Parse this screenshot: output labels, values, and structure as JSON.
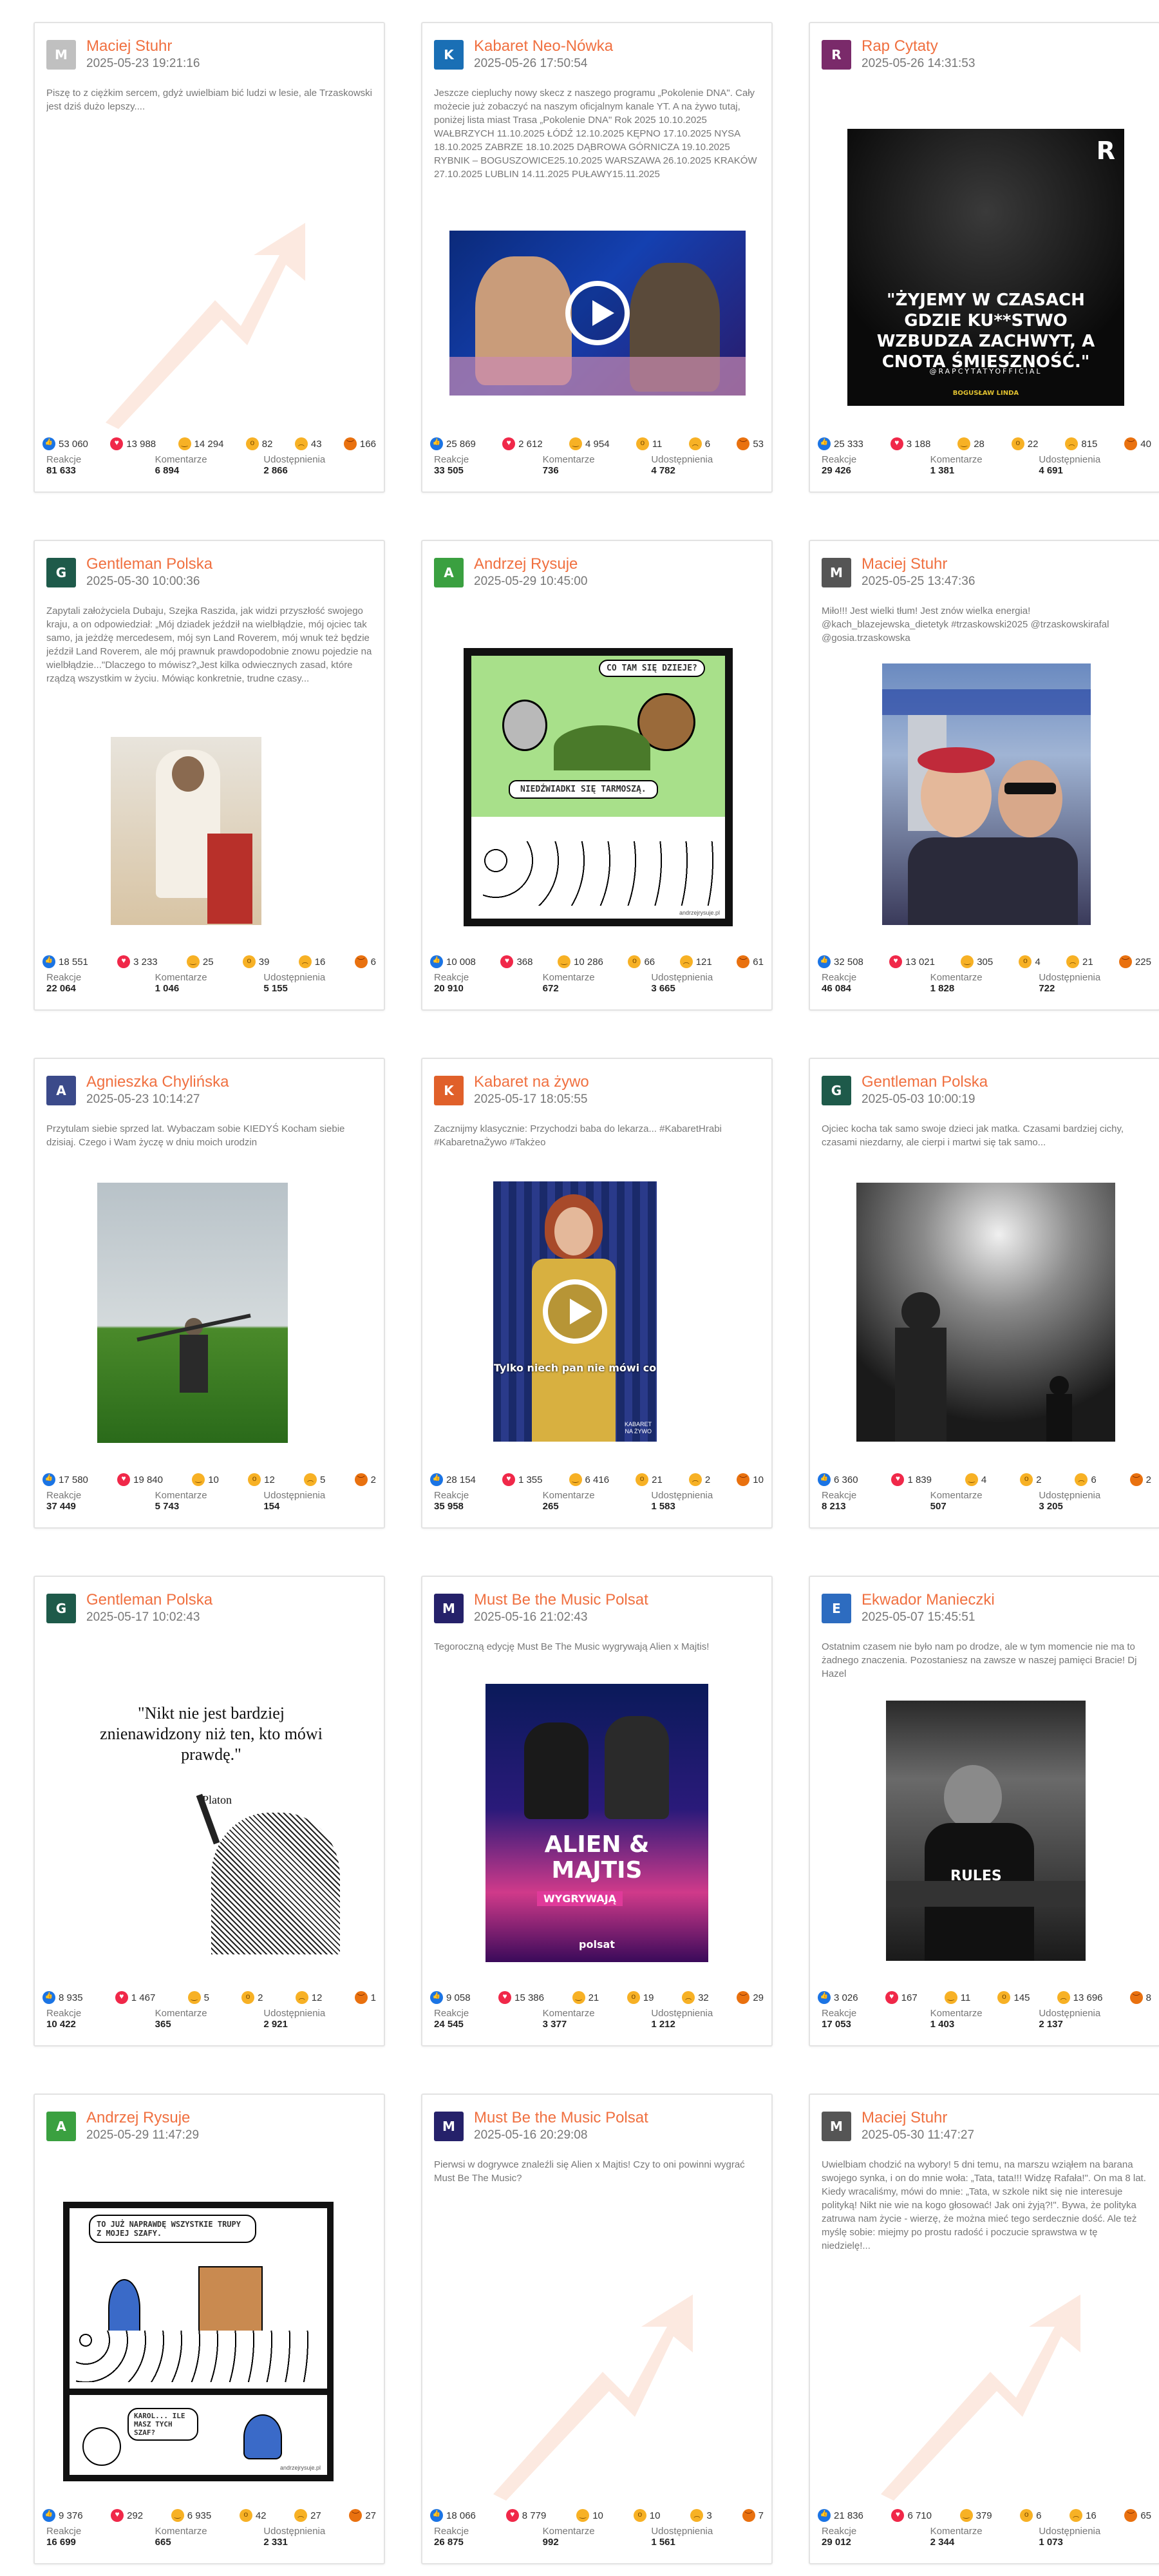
{
  "labels": {
    "reactions": "Reakcje",
    "comments": "Komentarze",
    "shares": "Udostępnienia"
  },
  "colors": {
    "author": "#f07040",
    "like": "#1b74e4",
    "love": "#f02849",
    "haha": "#f7b125",
    "angry": "#e9710f"
  },
  "posts": [
    {
      "author": "Maciej Stuhr",
      "date": "2025-05-23 19:21:16",
      "text": "Piszę to z ciężkim sercem, gdyż uwielbiam bić ludzi w lesie, ale Trzaskowski jest dziś dużo lepszy....",
      "reactions": {
        "like": "53 060",
        "love": "13 988",
        "haha": "14 294",
        "wow": "82",
        "sad": "43",
        "angry": "166"
      },
      "totals": {
        "reactions": "81 633",
        "comments": "6 894",
        "shares": "2 866"
      }
    },
    {
      "author": "Kabaret Neo-Nówka",
      "date": "2025-05-26 17:50:54",
      "text": "Jeszcze ciepluchy nowy skecz z naszego programu „Pokolenie DNA\". Cały możecie już zobaczyć na naszym oficjalnym kanale YT. A na żywo tutaj, poniżej lista miast Trasa „Pokolenie DNA\" Rok 2025 10.10.2025 WAŁBRZYCH 11.10.2025 ŁÓDŹ 12.10.2025 KĘPNO 17.10.2025 NYSA 18.10.2025 ZABRZE 18.10.2025 DĄBROWA GÓRNICZA 19.10.2025 RYBNIK – BOGUSZOWICE25.10.2025 WARSZAWA 26.10.2025 KRAKÓW 27.10.2025 LUBLIN 14.11.2025 PUŁAWY15.11.2025",
      "reactions": {
        "like": "25 869",
        "love": "2 612",
        "haha": "4 954",
        "wow": "11",
        "sad": "6",
        "angry": "53"
      },
      "totals": {
        "reactions": "33 505",
        "comments": "736",
        "shares": "4 782"
      }
    },
    {
      "author": "Rap Cytaty",
      "date": "2025-05-26 14:31:53",
      "text": "",
      "media_text": "\"ŻYJEMY W CZASACH GDZIE KU**STWO WZBUDZA ZACHWYT, A CNOTA ŚMIESZNOŚĆ.\"",
      "media_sub": "@RAPCYTATYOFFICIAL",
      "media_credit": "BOGUSŁAW LINDA",
      "reactions": {
        "like": "25 333",
        "love": "3 188",
        "haha": "28",
        "wow": "22",
        "sad": "815",
        "angry": "40"
      },
      "totals": {
        "reactions": "29 426",
        "comments": "1 381",
        "shares": "4 691"
      }
    },
    {
      "author": "Gentleman Polska",
      "date": "2025-05-30 10:00:36",
      "text": "Zapytali założyciela Dubaju, Szejka Raszida, jak widzi przyszłość swojego kraju, a on odpowiedział: „Mój dziadek jeździł na wielbłądzie, mój ojciec tak samo, ja jeżdżę mercedesem, mój syn Land Roverem, mój wnuk też będzie jeździł Land Roverem, ale mój prawnuk prawdopodobnie znowu pojedzie na wielbłądzie...\"Dlaczego to mówisz?„Jest kilka odwiecznych zasad, które rządzą wszystkim w życiu. Mówiąc konkretnie, trudne czasy...",
      "reactions": {
        "like": "18 551",
        "love": "3 233",
        "haha": "25",
        "wow": "39",
        "sad": "16",
        "angry": "6"
      },
      "totals": {
        "reactions": "22 064",
        "comments": "1 046",
        "shares": "5 155"
      }
    },
    {
      "author": "Andrzej Rysuje",
      "date": "2025-05-29 10:45:00",
      "text": "",
      "media_text": "CO TAM SIĘ DZIEJE?",
      "media_sub": "NIEDŹWIADKI SIĘ TARMOSZĄ.",
      "media_credit": "andrzejrysuje.pl",
      "reactions": {
        "like": "10 008",
        "love": "368",
        "haha": "10 286",
        "wow": "66",
        "sad": "121",
        "angry": "61"
      },
      "totals": {
        "reactions": "20 910",
        "comments": "672",
        "shares": "3 665"
      }
    },
    {
      "author": "Maciej Stuhr",
      "date": "2025-05-25 13:47:36",
      "text": "Miło!!! Jest wielki tłum! Jest znów wielka energia! @kach_blazejewska_dietetyk #trzaskowski2025 @trzaskowskirafal @gosia.trzaskowska",
      "reactions": {
        "like": "32 508",
        "love": "13 021",
        "haha": "305",
        "wow": "4",
        "sad": "21",
        "angry": "225"
      },
      "totals": {
        "reactions": "46 084",
        "comments": "1 828",
        "shares": "722"
      }
    },
    {
      "author": "Agnieszka Chylińska",
      "date": "2025-05-23 10:14:27",
      "text": "Przytulam siebie sprzed lat. Wybaczam sobie KIEDYŚ Kocham siebie dzisiaj. Czego i Wam życzę w dniu moich urodzin",
      "reactions": {
        "like": "17 580",
        "love": "19 840",
        "haha": "10",
        "wow": "12",
        "sad": "5",
        "angry": "2"
      },
      "totals": {
        "reactions": "37 449",
        "comments": "5 743",
        "shares": "154"
      }
    },
    {
      "author": "Kabaret na żywo",
      "date": "2025-05-17 18:05:55",
      "text": "Zacznijmy klasycznie: Przychodzi baba do lekarza... #KabaretHrabi #KabaretnaŻywo #Takżeo",
      "media_text": "Tylko niech pan nie mówi co",
      "media_credit": "KABARET NA ŻYWO",
      "reactions": {
        "like": "28 154",
        "love": "1 355",
        "haha": "6 416",
        "wow": "21",
        "sad": "2",
        "angry": "10"
      },
      "totals": {
        "reactions": "35 958",
        "comments": "265",
        "shares": "1 583"
      }
    },
    {
      "author": "Gentleman Polska",
      "date": "2025-05-03 10:00:19",
      "text": "Ojciec kocha tak samo swoje dzieci jak matka. Czasami bardziej cichy, czasami niezdarny, ale cierpi i martwi się tak samo...",
      "reactions": {
        "like": "6 360",
        "love": "1 839",
        "haha": "4",
        "wow": "2",
        "sad": "6",
        "angry": "2"
      },
      "totals": {
        "reactions": "8 213",
        "comments": "507",
        "shares": "3 205"
      }
    },
    {
      "author": "Gentleman Polska",
      "date": "2025-05-17 10:02:43",
      "text": "",
      "media_text": "\"Nikt nie jest bardziej znienawidzony niż ten, kto mówi prawdę.\"",
      "media_sub": "-Platon",
      "reactions": {
        "like": "8 935",
        "love": "1 467",
        "haha": "5",
        "wow": "2",
        "sad": "12",
        "angry": "1"
      },
      "totals": {
        "reactions": "10 422",
        "comments": "365",
        "shares": "2 921"
      }
    },
    {
      "author": "Must Be the Music Polsat",
      "date": "2025-05-16 21:02:43",
      "text": "Tegoroczną edycję Must Be The Music wygrywają Alien x Majtis!",
      "media_text": "ALIEN & MAJTIS",
      "media_sub": "WYGRYWAJĄ",
      "media_credit": "polsat",
      "reactions": {
        "like": "9 058",
        "love": "15 386",
        "haha": "21",
        "wow": "19",
        "sad": "32",
        "angry": "29"
      },
      "totals": {
        "reactions": "24 545",
        "comments": "3 377",
        "shares": "1 212"
      }
    },
    {
      "author": "Ekwador Manieczki",
      "date": "2025-05-07 15:45:51",
      "text": "Ostatnim czasem nie było nam po drodze, ale w tym momencie nie ma to żadnego znaczenia. Pozostaniesz na zawsze w naszej pamięci Bracie! Dj Hazel",
      "media_text": "RULES",
      "reactions": {
        "like": "3 026",
        "love": "167",
        "haha": "11",
        "wow": "145",
        "sad": "13 696",
        "angry": "8"
      },
      "totals": {
        "reactions": "17 053",
        "comments": "1 403",
        "shares": "2 137"
      }
    },
    {
      "author": "Andrzej Rysuje",
      "date": "2025-05-29 11:47:29",
      "text": "",
      "media_text": "TO JUŻ NAPRAWDĘ WSZYSTKIE TRUPY Z MOJEJ SZAFY.",
      "media_sub": "KAROL... ILE MASZ TYCH SZAF?",
      "media_credit": "andrzejrysuje.pl",
      "reactions": {
        "like": "9 376",
        "love": "292",
        "haha": "6 935",
        "wow": "42",
        "sad": "27",
        "angry": "27"
      },
      "totals": {
        "reactions": "16 699",
        "comments": "665",
        "shares": "2 331"
      }
    },
    {
      "author": "Must Be the Music Polsat",
      "date": "2025-05-16 20:29:08",
      "text": "Pierwsi w dogrywce znaleźli się Alien x Majtis! Czy to oni powinni wygrać Must Be The Music?",
      "reactions": {
        "like": "18 066",
        "love": "8 779",
        "haha": "10",
        "wow": "10",
        "sad": "3",
        "angry": "7"
      },
      "totals": {
        "reactions": "26 875",
        "comments": "992",
        "shares": "1 561"
      }
    },
    {
      "author": "Maciej Stuhr",
      "date": "2025-05-30 11:47:27",
      "text": "Uwielbiam chodzić na wybory! 5 dni temu, na marszu wziąłem na barana swojego synka, i on do mnie woła: „Tata, tata!!! Widzę Rafała!\". On ma 8 lat. Kiedy wracaliśmy, mówi do mnie: „Tata, w szkole nikt się nie interesuje polityką! Nikt nie wie na kogo głosować! Jak oni żyją?!\". Bywa, że polityka zatruwa nam życie - wierzę, że można mieć tego serdecznie dość. Ale też myślę sobie: miejmy po prostu radość i poczucie sprawstwa w tę niedzielę!...",
      "reactions": {
        "like": "21 836",
        "love": "6 710",
        "haha": "379",
        "wow": "6",
        "sad": "16",
        "angry": "65"
      },
      "totals": {
        "reactions": "29 012",
        "comments": "2 344",
        "shares": "1 073"
      }
    }
  ]
}
